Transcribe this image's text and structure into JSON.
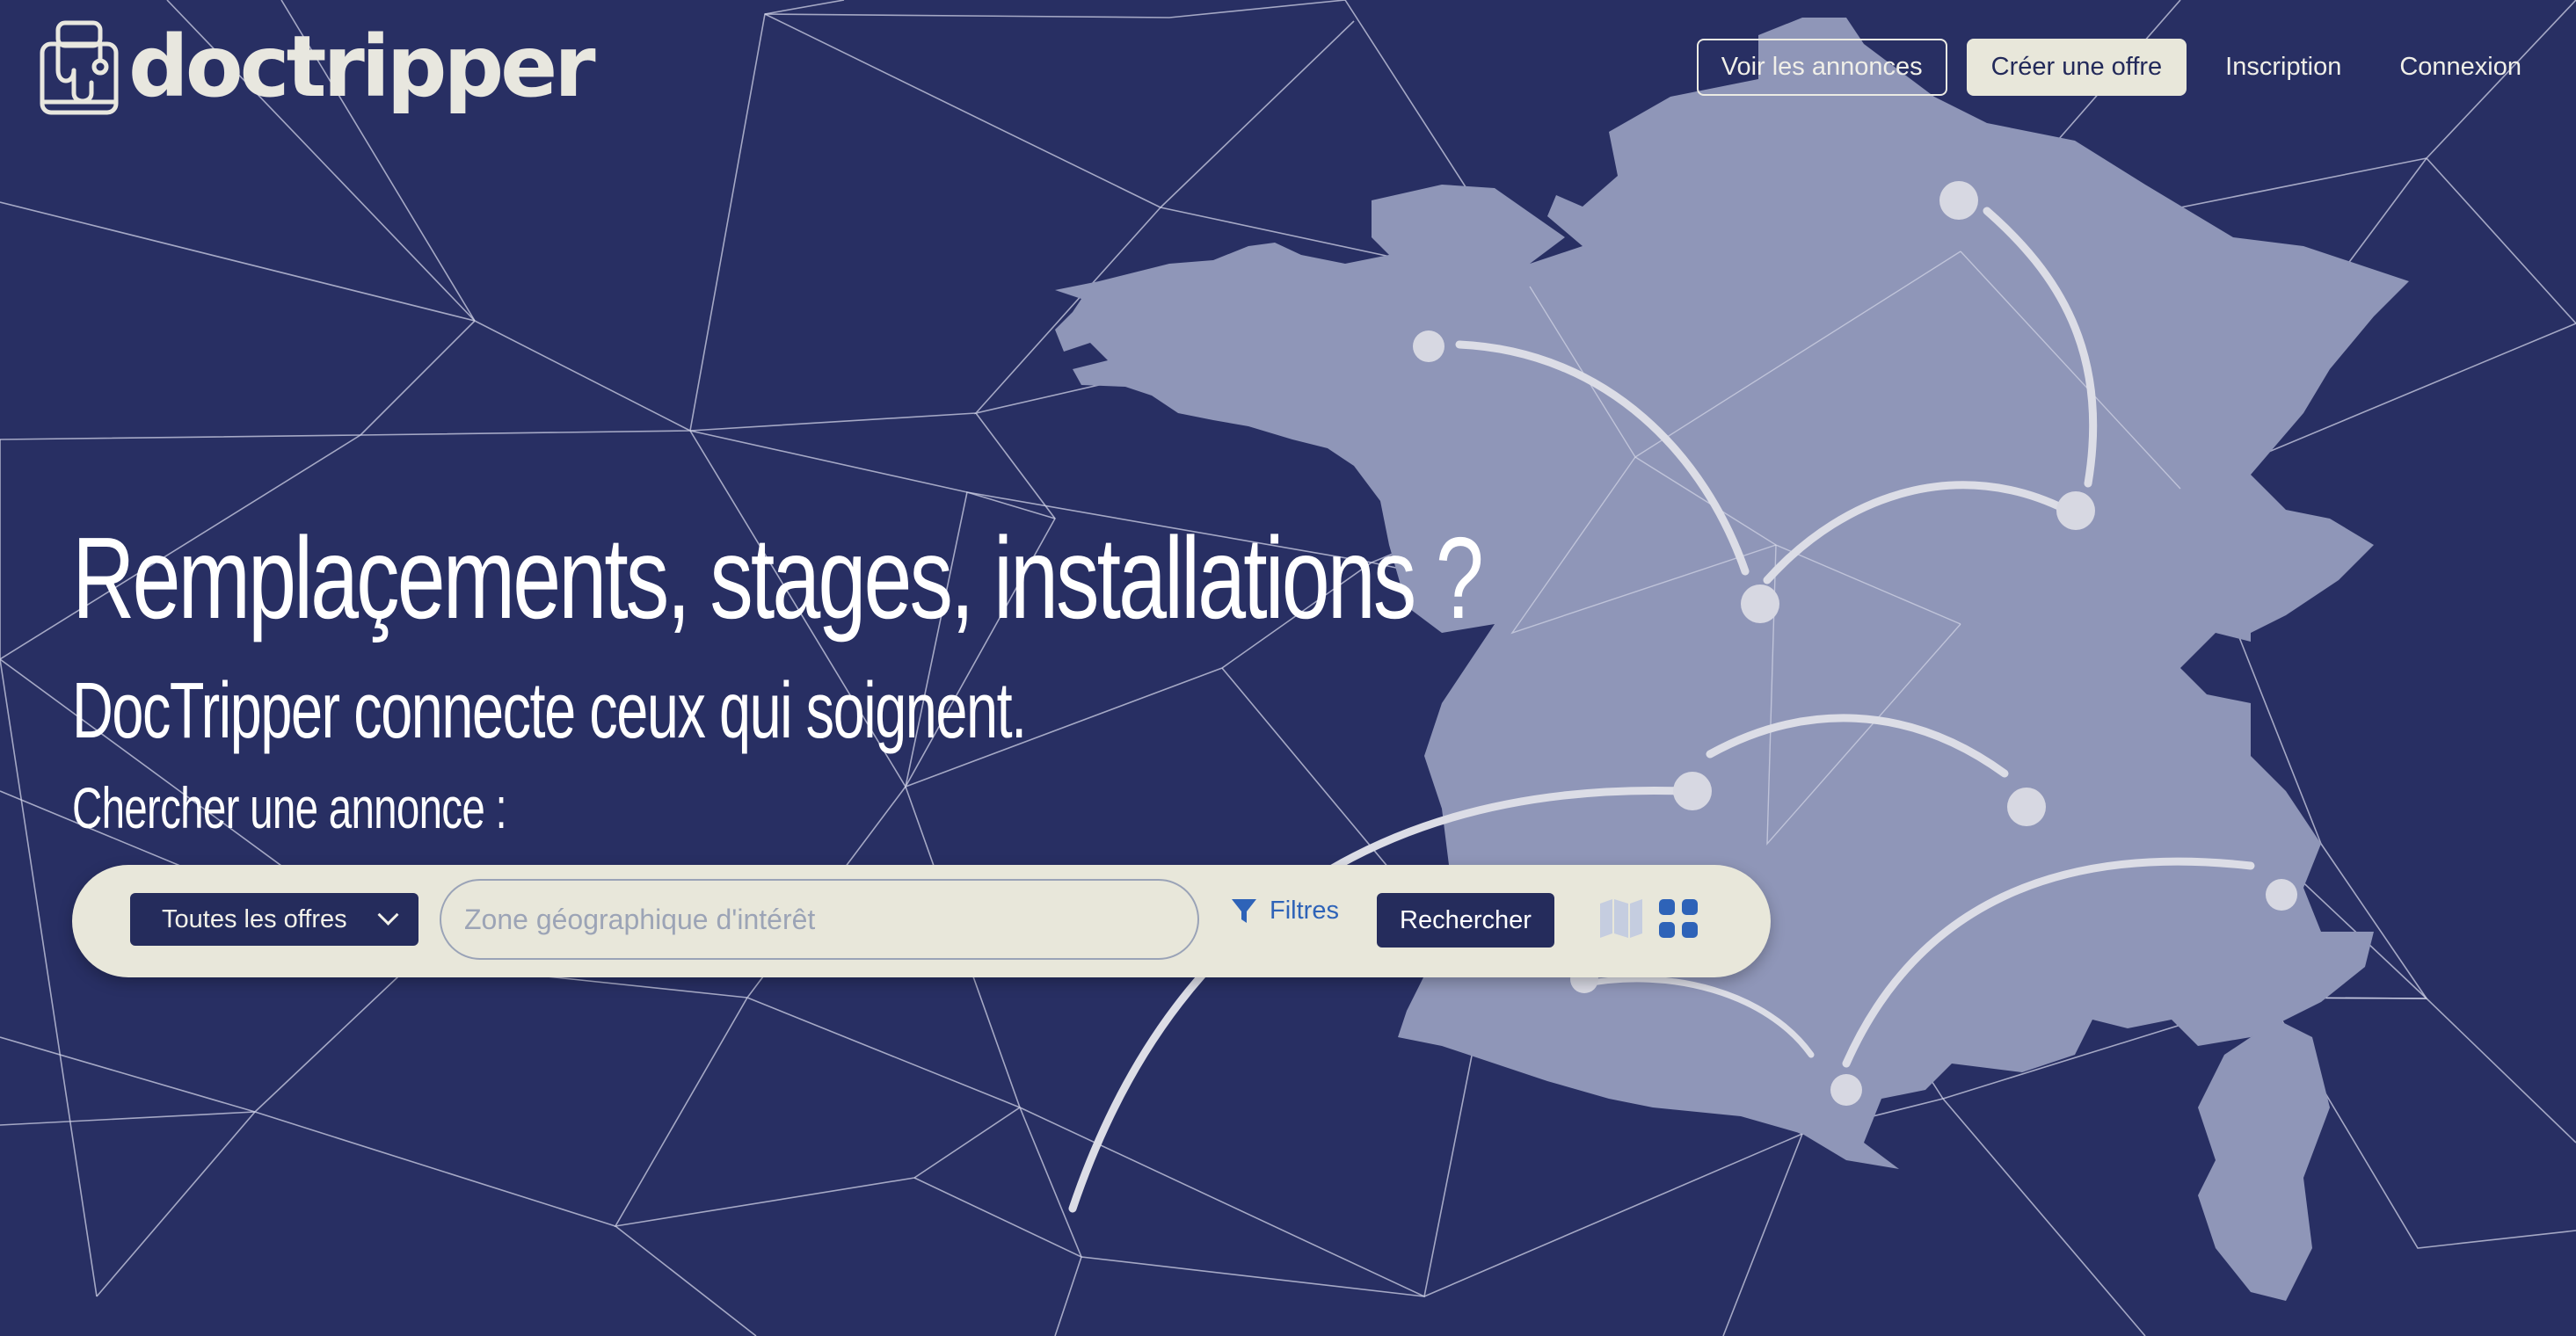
{
  "brand": {
    "name": "doctripper"
  },
  "nav": {
    "items": [
      {
        "label": "Voir les annonces"
      },
      {
        "label": "Créer une offre"
      },
      {
        "label": "Inscription"
      },
      {
        "label": "Connexion"
      }
    ]
  },
  "hero": {
    "title": "Remplaçements, stages, installations ?",
    "subtitle": "DocTripper connecte ceux qui soignent.",
    "search_label": "Chercher une annonce :"
  },
  "search": {
    "offer_select": "Toutes les offres",
    "zone_placeholder": "Zone géographique d'intérêt",
    "filters_label": "Filtres",
    "submit_label": "Rechercher"
  },
  "icons": {
    "logo": "doctor-suitcase-icon",
    "filter": "funnel-icon",
    "chevron": "chevron-down-icon",
    "map_view": "map-icon",
    "grid_view": "grid-icon"
  },
  "colors": {
    "background": "#282f63",
    "map_fill": "#8f96b8",
    "cream": "#e8e7da",
    "accent_blue": "#2e63b8"
  }
}
